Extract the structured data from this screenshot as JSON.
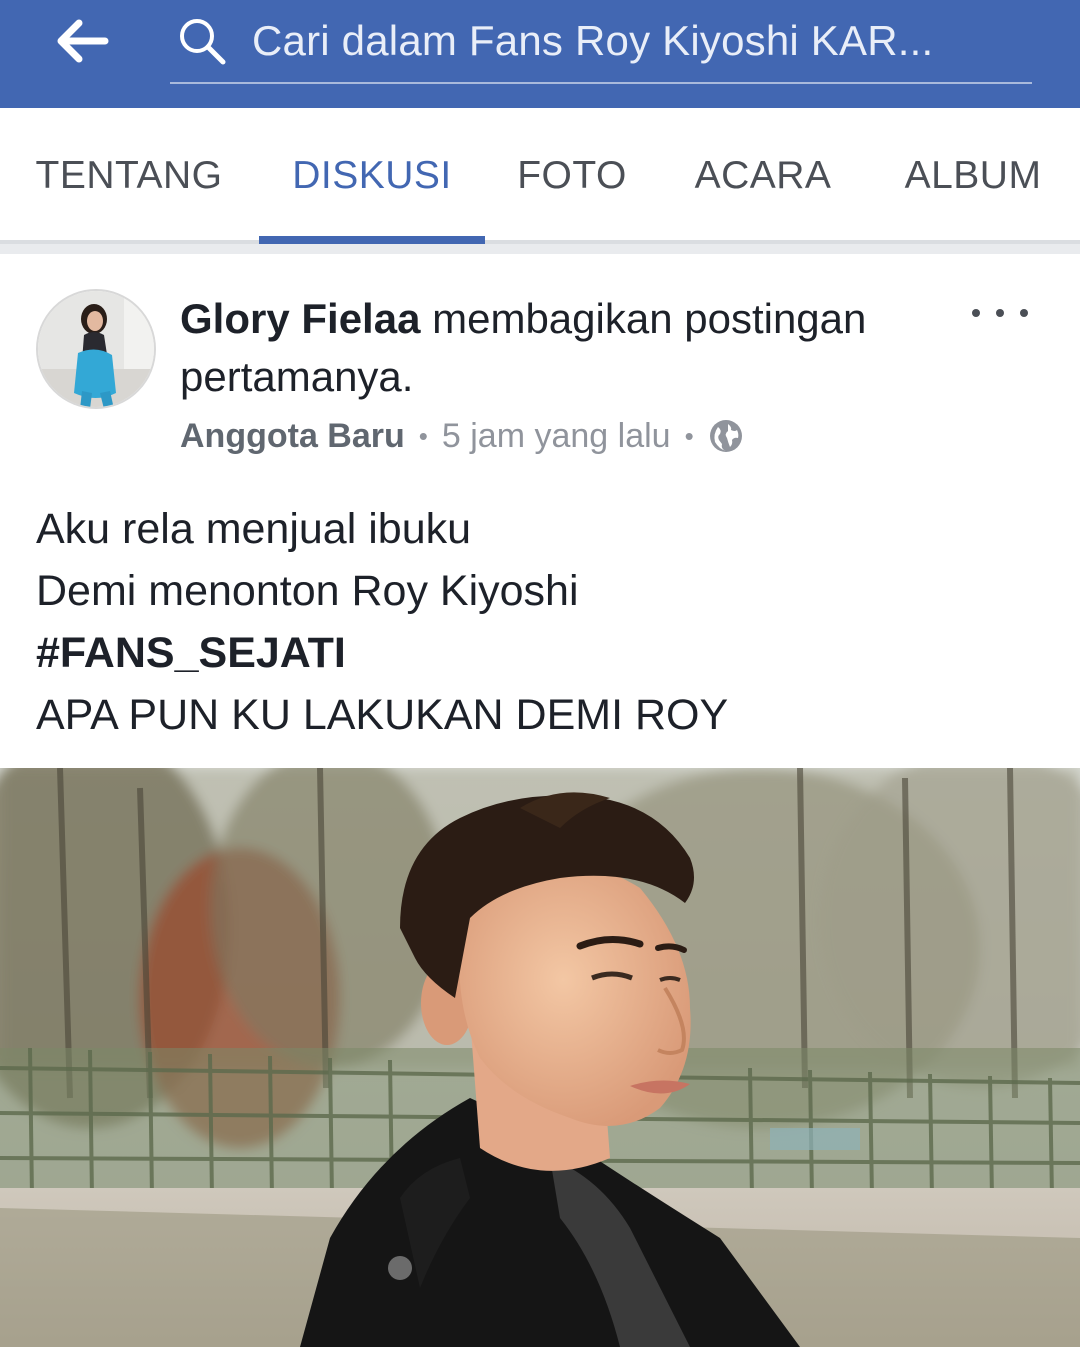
{
  "header": {
    "back_label": "Back",
    "search_placeholder": "Cari dalam Fans Roy Kiyoshi KAR..."
  },
  "tabs": [
    {
      "label": "TENTANG",
      "active": false
    },
    {
      "label": "DISKUSI",
      "active": true
    },
    {
      "label": "FOTO",
      "active": false
    },
    {
      "label": "ACARA",
      "active": false
    },
    {
      "label": "ALBUM",
      "active": false
    }
  ],
  "post": {
    "author": "Glory Fielaa",
    "action": " membagikan postingan pertamanya.",
    "badge": "Anggota Baru",
    "time": "5 jam yang lalu",
    "privacy_icon": "globe-icon",
    "more_icon": "ellipsis-icon",
    "lines": [
      "Aku rela menjual ibuku",
      "Demi menonton Roy Kiyoshi"
    ],
    "hashtag": "#FANS_SEJATI",
    "closing_line": "APA PUN KU LAKUKAN DEMI ROY",
    "photo_alt": "photo-of-man-in-black-coat-outdoors"
  },
  "colors": {
    "brand": "#4267b2",
    "text": "#1d2129",
    "meta": "#90949c"
  }
}
